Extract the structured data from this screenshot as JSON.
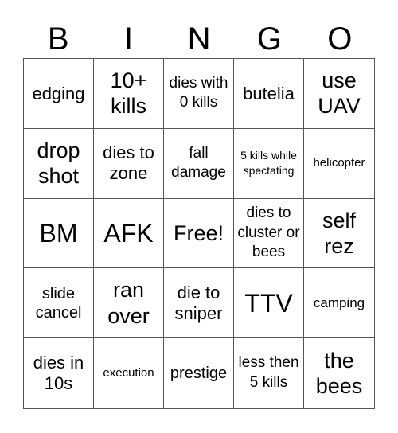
{
  "header": {
    "letters": [
      "B",
      "I",
      "N",
      "G",
      "O"
    ]
  },
  "cells": [
    "edging",
    "10+ kills",
    "dies with 0 kills",
    "butelia",
    "use UAV",
    "drop shot",
    "dies to zone",
    "fall damage",
    "5 kills while spectating",
    "helicopter",
    "BM",
    "AFK",
    "Free!",
    "dies to cluster or bees",
    "self rez",
    "slide cancel",
    "ran over",
    "die to sniper",
    "TTV",
    "camping",
    "dies in 10s",
    "execution",
    "prestige",
    "less then 5 kills",
    "the bees"
  ]
}
